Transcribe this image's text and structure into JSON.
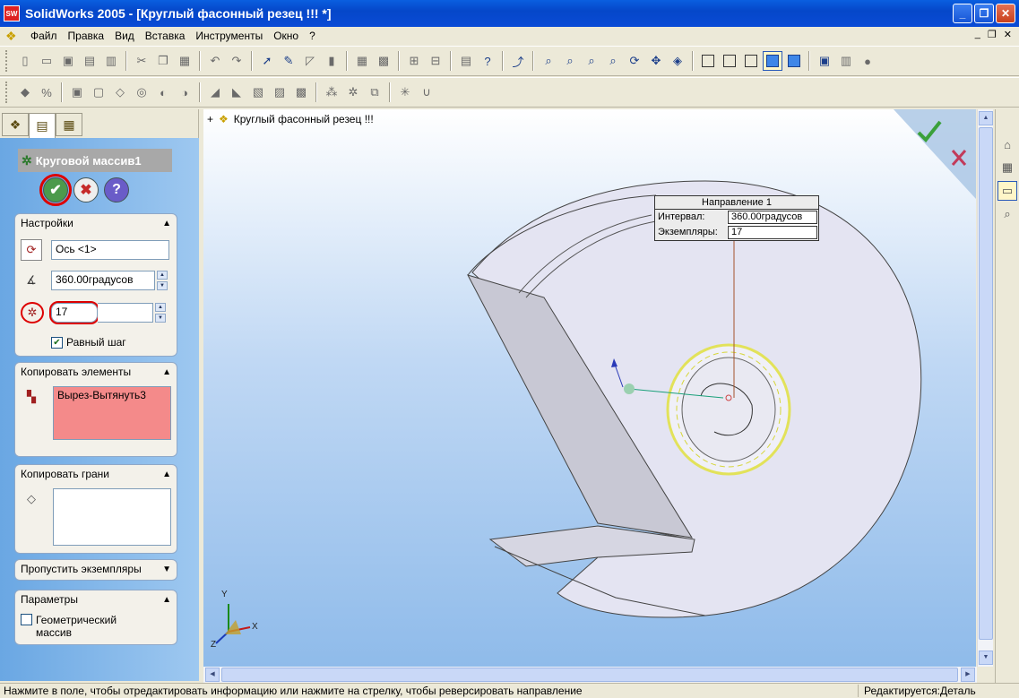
{
  "window": {
    "title": "SolidWorks 2005 - [Круглый фасонный резец !!! *]",
    "app_icon": "SW",
    "controls": {
      "minimize": "_",
      "restore": "❐",
      "close": "✕"
    }
  },
  "menu": {
    "items": [
      "Файл",
      "Правка",
      "Вид",
      "Вставка",
      "Инструменты",
      "Окно",
      "?"
    ],
    "mdi_controls": {
      "minimize": "_",
      "restore": "❐",
      "close": "✕"
    }
  },
  "feature_manager": {
    "tabs": [
      "feature-tree",
      "property-manager",
      "configuration-manager"
    ],
    "title": "Круговой массив1",
    "buttons": {
      "ok": "✔",
      "cancel": "✖",
      "help": "?"
    },
    "settings": {
      "header": "Настройки",
      "axis_value": "Ось <1>",
      "angle_value": "360.00градусов",
      "instances_value": "17",
      "equal_spacing_label": "Равный шаг",
      "equal_spacing_checked": true
    },
    "copy_features": {
      "header": "Копировать элементы",
      "items": [
        "Вырез-Вытянуть3"
      ]
    },
    "copy_faces": {
      "header": "Копировать грани",
      "items": []
    },
    "skip_instances": {
      "header": "Пропустить экземпляры"
    },
    "options": {
      "header": "Параметры",
      "geometry_pattern_line1": "Геометрический",
      "geometry_pattern_line2": "массив",
      "geometry_pattern_checked": false
    }
  },
  "viewport": {
    "breadcrumb": "Круглый фасонный резец !!!",
    "callout": {
      "title": "Направление 1",
      "interval_label": "Интервал:",
      "interval_value": "360.00градусов",
      "instances_label": "Экземпляры:",
      "instances_value": "17"
    },
    "triad": {
      "x": "X",
      "y": "Y",
      "z": "Z"
    },
    "background_top": "#ffffff",
    "background_bottom": "#8fbbea"
  },
  "statusbar": {
    "message": "Нажмите в поле, чтобы отредактировать информацию или нажмите на стрелку, чтобы реверсировать направление",
    "mode": "Редактируется:Деталь"
  },
  "colors": {
    "titlebar": "#0547c9",
    "accent_green": "#4c9a4c",
    "accent_red": "#c62a2a",
    "highlight_pink": "#f48a8a"
  }
}
